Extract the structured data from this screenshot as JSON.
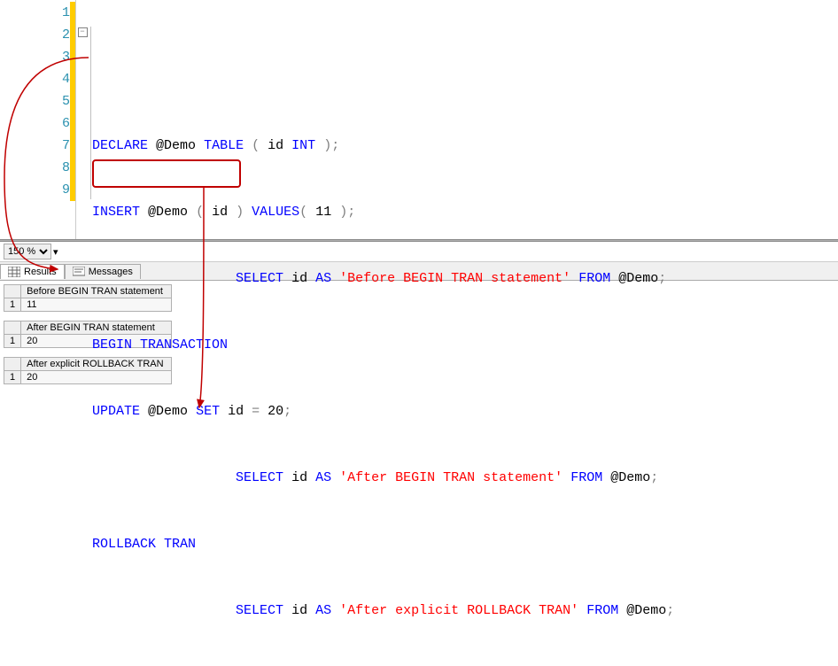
{
  "editor": {
    "lines": [
      "1",
      "2",
      "3",
      "4",
      "5",
      "6",
      "7",
      "8",
      "9"
    ],
    "code": {
      "l2": {
        "declare": "DECLARE",
        "var": "@Demo",
        "table": "TABLE",
        "open": "(",
        "id": "id",
        "int": "INT",
        "close": ")",
        "semi": ";"
      },
      "l3": {
        "insert": "INSERT",
        "var": "@Demo",
        "open": "(",
        "id": "id",
        "close": ")",
        "values": "VALUES",
        "open2": "(",
        "num": "11",
        "close2": ")",
        "semi": ";"
      },
      "l4": {
        "select": "SELECT",
        "id": "id",
        "as": "AS",
        "str": "'Before BEGIN TRAN statement'",
        "from": "FROM",
        "var": "@Demo",
        "semi": ";"
      },
      "l5": {
        "begin": "BEGIN",
        "tran": "TRANSACTION"
      },
      "l6": {
        "update": "UPDATE",
        "var": "@Demo",
        "set": "SET",
        "id": "id",
        "eq": "=",
        "num": "20",
        "semi": ";"
      },
      "l7": {
        "select": "SELECT",
        "id": "id",
        "as": "AS",
        "str": "'After BEGIN TRAN statement'",
        "from": "FROM",
        "var": "@Demo",
        "semi": ";"
      },
      "l8": {
        "rollback": "ROLLBACK",
        "tran": "TRAN"
      },
      "l9": {
        "select": "SELECT",
        "id": "id",
        "as": "AS",
        "str": "'After explicit ROLLBACK TRAN'",
        "from": "FROM",
        "var": "@Demo",
        "semi": ";"
      }
    }
  },
  "zoom": {
    "value": "150 %"
  },
  "tabs": {
    "results": "Results",
    "messages": "Messages"
  },
  "results": [
    {
      "header": "Before BEGIN TRAN statement",
      "row": "1",
      "value": "11"
    },
    {
      "header": "After BEGIN TRAN statement",
      "row": "1",
      "value": "20"
    },
    {
      "header": "After explicit ROLLBACK TRAN",
      "row": "1",
      "value": "20"
    }
  ],
  "fold": "−"
}
